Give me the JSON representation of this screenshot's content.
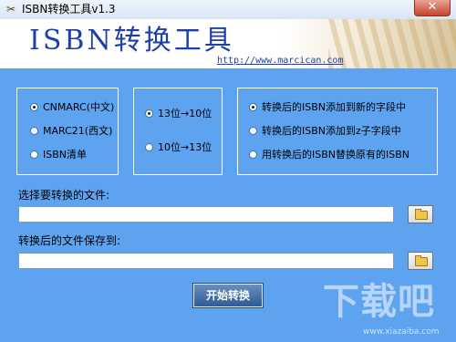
{
  "window": {
    "title": "ISBN转换工具v1.3",
    "close_glyph": "✕",
    "app_icon": "tools-icon"
  },
  "banner": {
    "title": "ISBN转换工具",
    "link": "http://www.marcican.com"
  },
  "format_group": {
    "options": [
      {
        "label": "CNMARC(中文)",
        "checked": true
      },
      {
        "label": "MARC21(西文)",
        "checked": false
      },
      {
        "label": "ISBN清单",
        "checked": false
      }
    ]
  },
  "direction_group": {
    "options": [
      {
        "label": "13位→10位",
        "checked": true
      },
      {
        "label": "10位→13位",
        "checked": false
      }
    ]
  },
  "mode_group": {
    "options": [
      {
        "label": "转换后的ISBN添加到新的字段中",
        "checked": true
      },
      {
        "label": "转换后的ISBN添加到z子字段中",
        "checked": false
      },
      {
        "label": "用转换后的ISBN替换原有的ISBN",
        "checked": false
      }
    ]
  },
  "input_file": {
    "label": "选择要转换的文件:",
    "value": ""
  },
  "output_file": {
    "label": "转换后的文件保存到:",
    "value": ""
  },
  "start_button": "开始转换",
  "watermark": {
    "text": "下载吧",
    "url": "www.xiazaiba.com"
  }
}
